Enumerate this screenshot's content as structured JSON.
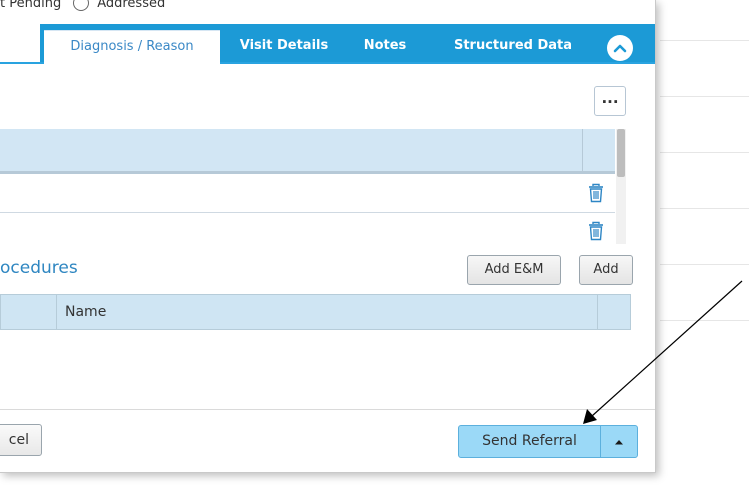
{
  "status_radios": {
    "pending_label": "t Pending",
    "addressed_label": "Addressed"
  },
  "tabs": [
    {
      "label": "Diagnosis / Reason",
      "active": true
    },
    {
      "label": "Visit Details",
      "active": false
    },
    {
      "label": "Notes",
      "active": false
    },
    {
      "label": "Structured Data",
      "active": false
    }
  ],
  "more_button": {
    "label": "..."
  },
  "procedures": {
    "title": "ocedures",
    "add_em_label": "Add E&M",
    "add_label": "Add",
    "columns": [
      "",
      "Name"
    ]
  },
  "footer": {
    "cancel_label": "cel",
    "send_referral_label": "Send Referral"
  },
  "colors": {
    "tab_blue": "#1c9ad6",
    "header_blue": "#d2e6f4",
    "primary_button": "#9bd9f7"
  },
  "icons": [
    "chevron-up-icon",
    "trash-icon",
    "caret-up-icon"
  ]
}
